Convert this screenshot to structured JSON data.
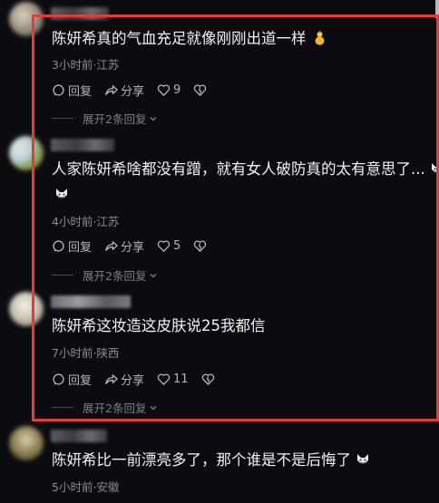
{
  "comments": [
    {
      "text": "陈妍希真的气血充足就像刚刚出道一样",
      "meta": "3小时前·江苏",
      "reply_label": "回复",
      "share_label": "分享",
      "like_count": "9",
      "expand_label": "展开2条回复"
    },
    {
      "text": "人家陈妍希啥都没有蹭，就有女人破防真的太有意思了...",
      "meta": "4小时前·江苏",
      "reply_label": "回复",
      "share_label": "分享",
      "like_count": "5",
      "expand_label": "展开2条回复"
    },
    {
      "text": "陈妍希这妆造这皮肤说25我都信",
      "meta": "7小时前·陕西",
      "reply_label": "回复",
      "share_label": "分享",
      "like_count": "11",
      "expand_label": "展开2条回复"
    },
    {
      "text": "陈妍希比一前漂亮多了，那个谁是不是后悔了",
      "meta": "5小时前·安徽"
    }
  ],
  "colors": {
    "highlight_border": "#e53b3b",
    "background": "#0c0c10"
  },
  "icons": [
    "comment-icon",
    "share-icon",
    "heart-icon",
    "dislike-heart-icon",
    "chevron-down-icon",
    "fox-emoji-icon",
    "gourd-emoji-icon"
  ]
}
